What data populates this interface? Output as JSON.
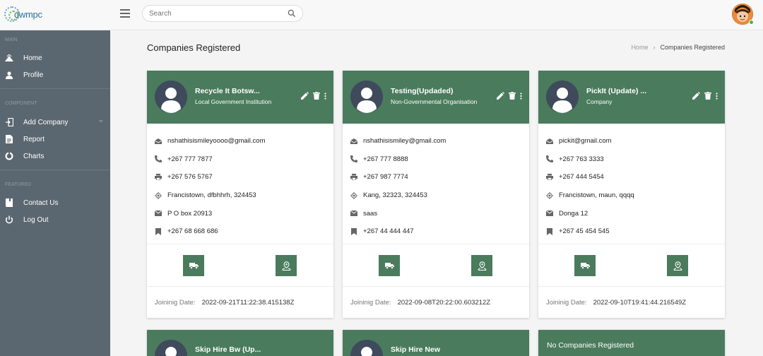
{
  "app": {
    "logo_text": "dwmpc",
    "search_placeholder": "Search"
  },
  "sidebar": {
    "sections": [
      {
        "label": "MAIN"
      },
      {
        "label": "COMPONENT"
      },
      {
        "label": "FEATURED"
      }
    ],
    "items": [
      {
        "label": "Home",
        "icon": "home-icon"
      },
      {
        "label": "Profile",
        "icon": "person-icon"
      },
      {
        "label": "Add Company",
        "icon": "login-icon"
      },
      {
        "label": "Report",
        "icon": "document-icon"
      },
      {
        "label": "Charts",
        "icon": "donut-chart-icon"
      },
      {
        "label": "Contact Us",
        "icon": "book-icon"
      },
      {
        "label": "Log Out",
        "icon": "power-icon"
      }
    ]
  },
  "page": {
    "title": "Companies Registered",
    "breadcrumb": {
      "home": "Home",
      "separator": "›",
      "current": "Companies Registered"
    }
  },
  "labels": {
    "joining_date": "Joininig Date:",
    "no_companies": "No Companies Registered"
  },
  "colors": {
    "accent": "#4a7b5d",
    "sidebar": "#5b6770"
  },
  "cards": [
    {
      "name": "Recycle It Botsw...",
      "type": "Local Government Institution",
      "email": "nshathisismileyoooo@gmail.com",
      "phone": "+267 777 7877",
      "fax": "+267 576 5767",
      "location": "Francistown, dfbhhrh, 324453",
      "mail": "P O box 20913",
      "bookmark": "+267 68 668 686",
      "joined": "2022-09-21T11:22:38.415138Z"
    },
    {
      "name": "Testing(Updaded)",
      "type": "Non-Governmental Organisation",
      "email": "nshathisismiley@gmail.com",
      "phone": "+267 777 8888",
      "fax": "+267 987 7774",
      "location": "Kang, 32323, 324453",
      "mail": "saas",
      "bookmark": "+267 44 444 447",
      "joined": "2022-09-08T20:22:00.603212Z"
    },
    {
      "name": "PickIt (Update) ...",
      "type": "Company",
      "email": "pickit@gmail.com",
      "phone": "+267 763 3333",
      "fax": "+267 444 5454",
      "location": "Francistown, maun, qqqq",
      "mail": "Donga 12",
      "bookmark": "+267 45 454 545",
      "joined": "2022-09-10T19:41:44.216549Z"
    }
  ],
  "partial_cards": [
    {
      "name": "Skip Hire Bw (Up..."
    },
    {
      "name": "Skip Hire New"
    }
  ]
}
